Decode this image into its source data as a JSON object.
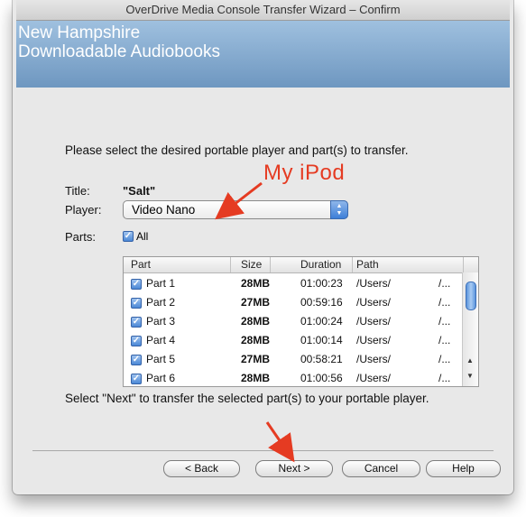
{
  "window": {
    "title": "OverDrive Media Console Transfer Wizard – Confirm"
  },
  "banner": {
    "line1": "New Hampshire",
    "line2": "Downloadable Audiobooks"
  },
  "instruction": "Please select the desired portable player and part(s) to transfer.",
  "fields": {
    "title_label": "Title:",
    "title_value": "\"Salt\"",
    "player_label": "Player:",
    "player_value": "Video Nano",
    "parts_label": "Parts:",
    "all_label": "All"
  },
  "table": {
    "columns": [
      "Part",
      "Size",
      "Duration",
      "Path"
    ],
    "rows": [
      {
        "part": "Part 1",
        "size": "28MB",
        "duration": "01:00:23",
        "path": "/Users/",
        "path_end": "/..."
      },
      {
        "part": "Part 2",
        "size": "27MB",
        "duration": "00:59:16",
        "path": "/Users/",
        "path_end": "/..."
      },
      {
        "part": "Part 3",
        "size": "28MB",
        "duration": "01:00:24",
        "path": "/Users/",
        "path_end": "/..."
      },
      {
        "part": "Part 4",
        "size": "28MB",
        "duration": "01:00:14",
        "path": "/Users/",
        "path_end": "/..."
      },
      {
        "part": "Part 5",
        "size": "27MB",
        "duration": "00:58:21",
        "path": "/Users/",
        "path_end": "/..."
      },
      {
        "part": "Part 6",
        "size": "28MB",
        "duration": "01:00:56",
        "path": "/Users/",
        "path_end": "/..."
      }
    ]
  },
  "footer_text": "Select \"Next\" to transfer the selected part(s) to your portable player.",
  "buttons": {
    "back": "< Back",
    "next": "Next >",
    "cancel": "Cancel",
    "help": "Help"
  },
  "annotation": {
    "text": "My iPod",
    "color": "#e53b22"
  },
  "colors": {
    "banner": "#7fa6cc",
    "accent": "#4b88d6"
  }
}
